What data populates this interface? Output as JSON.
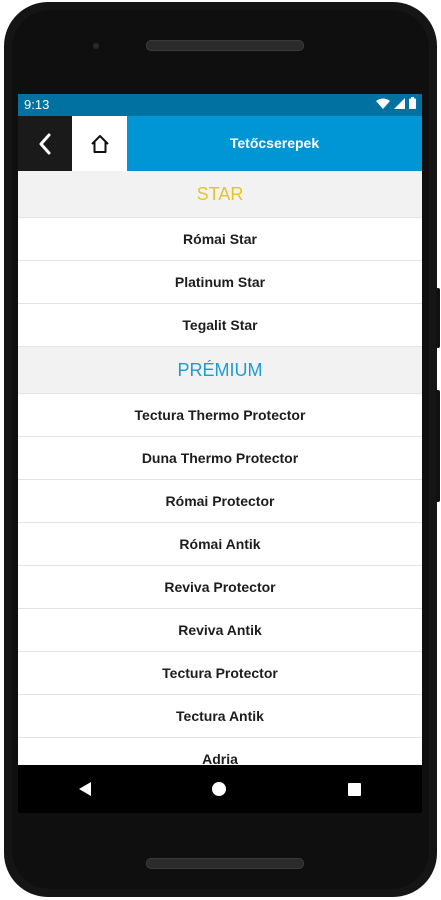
{
  "status": {
    "time": "9:13"
  },
  "appbar": {
    "title": "Tetőcserepek"
  },
  "colors": {
    "star": "#e5c52b",
    "premium": "#1e9bd6",
    "accent": "#0096d6"
  },
  "sections": [
    {
      "title": "STAR",
      "items": [
        "Római Star",
        "Platinum Star",
        "Tegalit Star"
      ]
    },
    {
      "title": "PRÉMIUM",
      "items": [
        "Tectura Thermo Protector",
        "Duna Thermo Protector",
        "Római Protector",
        "Római Antik",
        "Reviva Protector",
        "Reviva Antik",
        "Tectura Protector",
        "Tectura Antik",
        "Adria"
      ]
    }
  ]
}
